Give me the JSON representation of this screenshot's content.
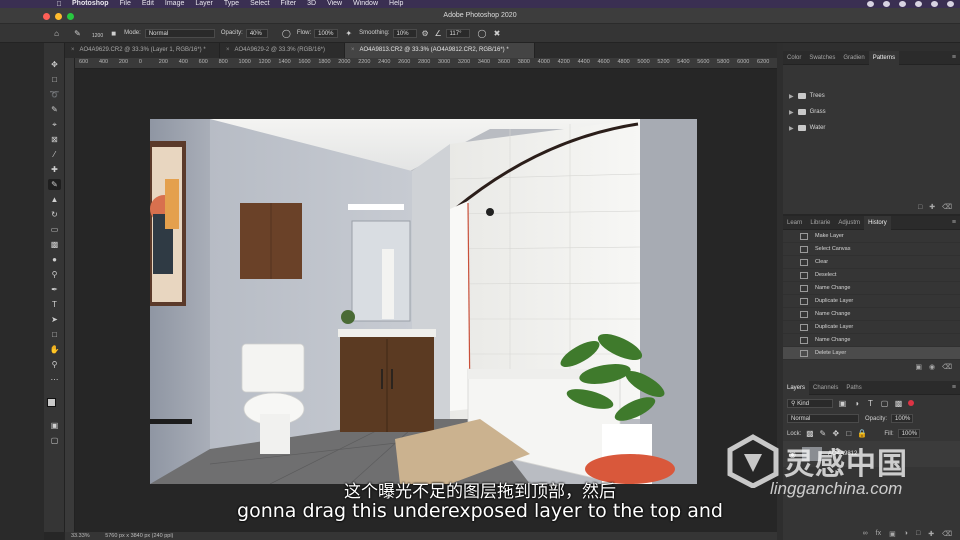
{
  "menubar": {
    "app_name": "Photoshop",
    "items": [
      "File",
      "Edit",
      "Image",
      "Layer",
      "Type",
      "Select",
      "Filter",
      "3D",
      "View",
      "Window",
      "Help"
    ]
  },
  "window": {
    "title": "Adobe Photoshop 2020"
  },
  "options": {
    "brush_size": "1200",
    "mode_label": "Mode:",
    "mode_value": "Normal",
    "opacity_label": "Opacity:",
    "opacity_value": "40%",
    "flow_label": "Flow:",
    "flow_value": "100%",
    "smoothing_label": "Smoothing:",
    "smoothing_value": "10%",
    "angle_value": "117°"
  },
  "doc_tabs": [
    {
      "label": "AO4A9629.CR2 @ 33.3% (Layer 1, RGB/16*) *",
      "active": false
    },
    {
      "label": "AO4A9629-2 @ 33.3% (RGB/16*)",
      "active": false
    },
    {
      "label": "AO4A9813.CR2 @ 33.3% (AO4A9812.CR2, RGB/16*) *",
      "active": true
    }
  ],
  "ruler_ticks": [
    "600",
    "400",
    "200",
    "0",
    "200",
    "400",
    "600",
    "800",
    "1000",
    "1200",
    "1400",
    "1600",
    "1800",
    "2000",
    "2200",
    "2400",
    "2600",
    "2800",
    "3000",
    "3200",
    "3400",
    "3600",
    "3800",
    "4000",
    "4200",
    "4400",
    "4600",
    "4800",
    "5000",
    "5200",
    "5400",
    "5600",
    "5800",
    "6000",
    "6200"
  ],
  "status": {
    "zoom": "33.33%",
    "doc_size": "5760 px x 3840 px (240 ppi)"
  },
  "swatches_panel": {
    "tabs": [
      "Color",
      "Swatches",
      "Gradien",
      "Patterns"
    ],
    "active_tab": "Patterns",
    "folders": [
      "Trees",
      "Grass",
      "Water"
    ]
  },
  "history_panel": {
    "tabs": [
      "Learn",
      "Librarie",
      "Adjustm",
      "History"
    ],
    "active_tab": "History",
    "items": [
      "Make Layer",
      "Select Canvas",
      "Clear",
      "Deselect",
      "Name Change",
      "Duplicate Layer",
      "Name Change",
      "Duplicate Layer",
      "Name Change",
      "Delete Layer"
    ],
    "active_index": 9
  },
  "layers_panel": {
    "tabs": [
      "Layers",
      "Channels",
      "Paths"
    ],
    "active_tab": "Layers",
    "filter_label": "Kind",
    "blend_mode": "Normal",
    "opacity_label": "Opacity:",
    "opacity_value": "100%",
    "lock_label": "Lock:",
    "fill_label": "Fill:",
    "fill_value": "100%",
    "layer_name": "AO4A9812"
  },
  "subtitles": {
    "chinese": "这个曝光不足的图层拖到顶部，然后",
    "english": "gonna drag this underexposed layer to the top and"
  },
  "watermark": {
    "cn": "灵感中国",
    "en": "lingganchina.com"
  },
  "colors": {
    "menubar": "#3a2f52",
    "ui_dark": "#353535",
    "close": "#fe5f57",
    "minimize": "#febc2e",
    "zoom": "#28c840"
  }
}
